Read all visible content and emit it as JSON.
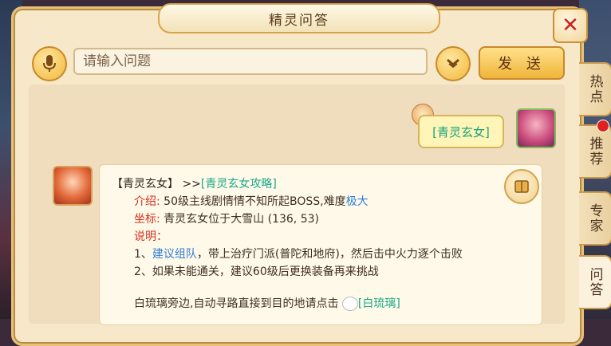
{
  "window": {
    "title": "精灵问答",
    "close_icon": "close-icon"
  },
  "toolbar": {
    "mic_icon": "microphone-icon",
    "search_placeholder": "请输入问题",
    "dropdown_icon": "chevron-down-icon",
    "send_label": "发 送"
  },
  "tabs": [
    {
      "label": "热点",
      "active": false
    },
    {
      "label": "推荐",
      "active": false,
      "badge": true
    },
    {
      "label": "专家",
      "active": false
    },
    {
      "label": "问答",
      "active": true
    }
  ],
  "user_message": {
    "text": "[青灵玄女]"
  },
  "answer": {
    "title": "【青灵玄女】",
    "arrow": ">>",
    "link": "[青灵玄女攻略]",
    "intro_label": "介绍:",
    "intro_text": "50级主线剧情情不知所起BOSS,难度",
    "intro_difficulty": "极大",
    "coord_label": "坐标:",
    "coord_text": "青灵玄女位于大雪山 (136, 53)",
    "note_label": "说明：",
    "note1_prefix": "1、",
    "note1_link": "建议组队",
    "note1_text": "，带上治疗门派(普陀和地府)，然后击中火力逐个击败",
    "note2": "2、如果未能通关，建议60级后更换装备再来挑战",
    "footer_text": "白琉璃旁边,自动寻路直接到目的地请点击",
    "footer_link": "[白琉璃]"
  },
  "colors": {
    "accent": "#f0b53a",
    "link_teal": "#1aa888",
    "link_blue": "#2f7ed8",
    "label_red": "#d3301e"
  }
}
